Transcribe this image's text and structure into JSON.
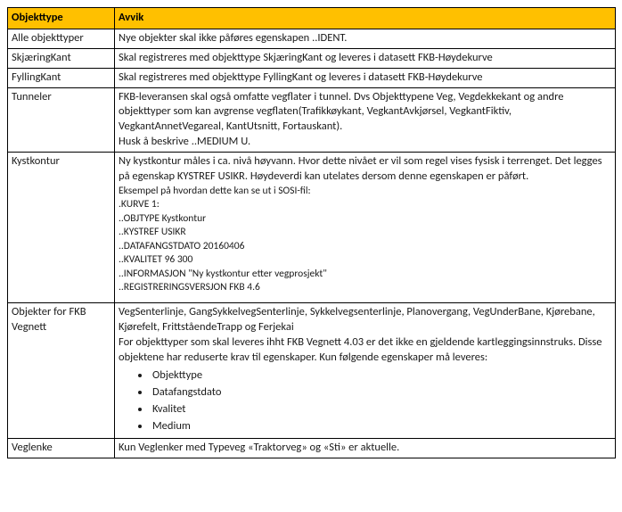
{
  "headers": {
    "col1": "Objekttype",
    "col2": "Avvik"
  },
  "rows": {
    "r1": {
      "type": "Alle objekttyper",
      "text": "Nye objekter skal ikke påføres egenskapen ..IDENT."
    },
    "r2": {
      "type": "SkjæringKant",
      "text": "Skal registreres med objekttype SkjæringKant og leveres i datasett FKB-Høydekurve"
    },
    "r3": {
      "type": "FyllingKant",
      "text": "Skal registreres med objekttype FyllingKant og leveres i datasett  FKB-Høydekurve"
    },
    "r4": {
      "type": "Tunneler",
      "p1": "FKB-leveransen skal også omfatte vegflater i tunnel. Dvs Objekttypene Veg, Vegdekkekant og andre objekttyper som kan avgrense vegflaten(Trafikkøykant, VegkantAvkjørsel, VegkantFiktiv, VegkantAnnetVegareal, KantUtsnitt, Fortauskant).",
      "p2": "Husk å beskrive ..MEDIUM U."
    },
    "r5": {
      "type": "Kystkontur",
      "p1": "Ny kystkontur måles i ca. nivå høyvann. Hvor dette nivået er vil som regel vises fysisk i terrenget. Det legges på egenskap KYSTREF USIKR. Høydeverdi kan utelates dersom denne egenskapen er påført.",
      "p2": "Eksempel på hvordan dette kan se ut i SOSI-fil:",
      "l1": ".KURVE 1:",
      "l2": "..OBJTYPE Kystkontur",
      "l3": "..KYSTREF USIKR",
      "l4": "..DATAFANGSTDATO 20160406",
      "l5": "..KVALITET 96 300",
      "l6": "..INFORMASJON \"Ny kystkontur etter vegprosjekt\"",
      "l7": "..REGISTRERINGSVERSJON FKB 4.6"
    },
    "r6": {
      "type": "Objekter for FKB Vegnett",
      "p1": "VegSenterlinje, GangSykkelvegSenterlinje, Sykkelvegsenterlinje, Planovergang, VegUnderBane, Kjørebane, Kjørefelt, FrittståendeTrapp og Ferjekai",
      "p2": "For objekttyper som skal leveres ihht FKB Vegnett 4.03 er det ikke en gjeldende kartleggingsinnstruks. Disse objektene har reduserte krav til egenskaper. Kun følgende egenskaper må leveres:",
      "b1": "Objekttype",
      "b2": "Datafangstdato",
      "b3": "Kvalitet",
      "b4": "Medium"
    },
    "r7": {
      "type": "Veglenke",
      "text": "Kun Veglenker med Typeveg «Traktorveg» og «Sti» er aktuelle."
    }
  }
}
